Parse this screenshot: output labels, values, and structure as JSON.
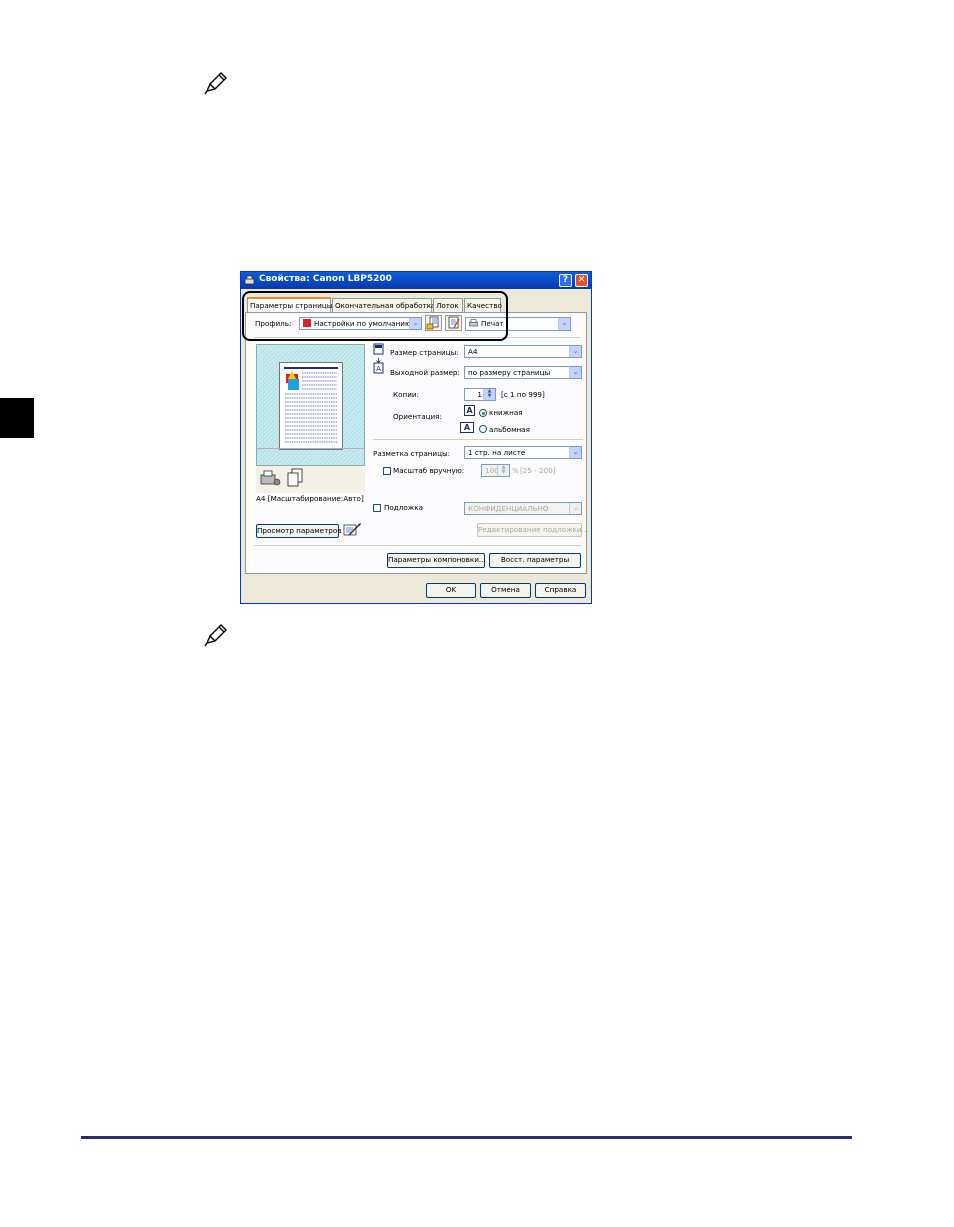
{
  "window": {
    "title": "Свойства: Canon LBP5200",
    "help_btn": "?",
    "close_btn": "✕"
  },
  "tabs": [
    {
      "label": "Параметры страницы"
    },
    {
      "label": "Окончательная обработка"
    },
    {
      "label": "Лоток"
    },
    {
      "label": "Качество"
    }
  ],
  "profile": {
    "label": "Профиль:",
    "value": "Настройки по умолчанию",
    "output_value": "Печат"
  },
  "page_settings": {
    "page_size_label": "Размер страницы:",
    "page_size_value": "A4",
    "output_size_label": "Выходной размер:",
    "output_size_value": "по размеру страницы",
    "copies_label": "Копии:",
    "copies_value": "1",
    "copies_range": "[с 1 по 999]",
    "orientation_label": "Ориентация:",
    "orientation_portrait": "книжная",
    "orientation_landscape": "альбомная",
    "layout_label": "Разметка страницы:",
    "layout_value": "1 стр. на листе",
    "manual_scale_label": "Масштаб вручную:",
    "manual_scale_value": "100",
    "manual_scale_unit": "%",
    "manual_scale_range": "[25 - 200]",
    "watermark_label": "Подложка",
    "watermark_value": "КОНФИДЕНЦИАЛЬНО",
    "edit_watermark_button": "Редактирование подложки..."
  },
  "preview": {
    "caption": "A4 [Масштабирование:Авто]",
    "view_settings_button": "Просмотр параметров"
  },
  "buttons": {
    "layout_options": "Параметры компоновки...",
    "restore_defaults": "Восст. параметры",
    "ok": "OK",
    "cancel": "Отмена",
    "help": "Справка"
  }
}
